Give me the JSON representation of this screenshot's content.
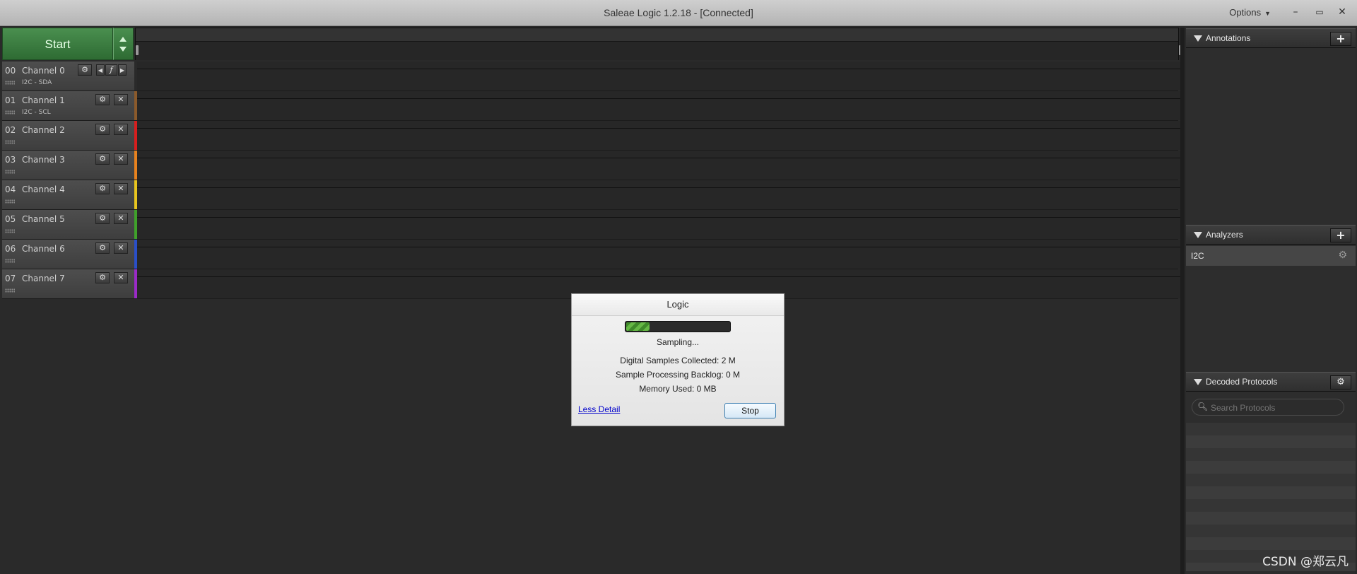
{
  "window": {
    "title": "Saleae Logic 1.2.18 - [Connected]",
    "options_label": "Options",
    "minimize": "–",
    "restore": "▭",
    "close": "✕"
  },
  "start_button": {
    "label": "Start"
  },
  "channels": [
    {
      "num": "00",
      "name": "Channel 0",
      "sub": "I2C - SDA",
      "color": "#2a2a2a"
    },
    {
      "num": "01",
      "name": "Channel 1",
      "sub": "I2C - SCL",
      "color": "#8b5a2b"
    },
    {
      "num": "02",
      "name": "Channel 2",
      "sub": "",
      "color": "#d81e1e"
    },
    {
      "num": "03",
      "name": "Channel 3",
      "sub": "",
      "color": "#e8821e"
    },
    {
      "num": "04",
      "name": "Channel 4",
      "sub": "",
      "color": "#e8c51e"
    },
    {
      "num": "05",
      "name": "Channel 5",
      "sub": "",
      "color": "#3fa12a"
    },
    {
      "num": "06",
      "name": "Channel 6",
      "sub": "",
      "color": "#2a4fc8"
    },
    {
      "num": "07",
      "name": "Channel 7",
      "sub": "",
      "color": "#9b2ac8"
    }
  ],
  "panels": {
    "annotations": {
      "title": "Annotations",
      "add": "+"
    },
    "analyzers": {
      "title": "Analyzers",
      "add": "+",
      "items": [
        {
          "name": "I2C"
        }
      ]
    },
    "decoded_protocols": {
      "title": "Decoded Protocols",
      "search_placeholder": "Search Protocols"
    }
  },
  "dialog": {
    "title": "Logic",
    "progress_fraction": 0.22,
    "status": "Sampling...",
    "digital_samples": "Digital Samples Collected: 2 M",
    "backlog": "Sample Processing Backlog: 0 M",
    "memory": "Memory Used: 0 MB",
    "less_detail": "Less Detail",
    "stop": "Stop"
  },
  "watermark": "CSDN @郑云凡"
}
